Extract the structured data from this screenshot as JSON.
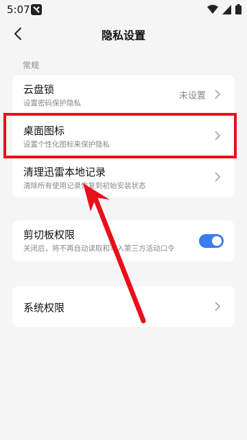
{
  "status_bar": {
    "time": "5:07"
  },
  "header": {
    "title": "隐私设置"
  },
  "sections": [
    {
      "label": "常规"
    }
  ],
  "group1": {
    "items": [
      {
        "title": "云盘锁",
        "subtitle": "设置密码保护隐私",
        "value": "未设置"
      },
      {
        "title": "桌面图标",
        "subtitle": "设置个性化图标来保护隐私"
      },
      {
        "title": "清理迅雷本地记录",
        "subtitle": "清除所有使用记录恢复到初始安装状态"
      }
    ]
  },
  "group2": {
    "items": [
      {
        "title": "剪切板权限",
        "subtitle": "关闭后，将不再自动读取和写入第三方活动口令",
        "toggle_on": true
      }
    ]
  },
  "group3": {
    "items": [
      {
        "title": "系统权限"
      }
    ]
  },
  "colors": {
    "accent": "#3d7cf0",
    "highlight": "#e8101a",
    "background": "#f5f5f5"
  }
}
